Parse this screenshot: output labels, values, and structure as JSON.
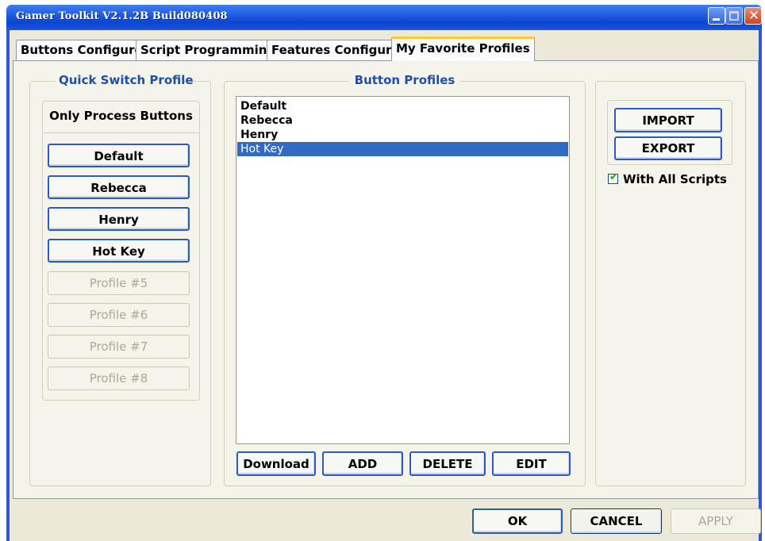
{
  "window": {
    "title": "Gamer Toolkit V2.1.2B Build080408"
  },
  "tabs": [
    {
      "label": "Buttons Configure"
    },
    {
      "label": "Script Programming"
    },
    {
      "label": "Features Configure"
    },
    {
      "label": "My Favorite Profiles",
      "active": true
    }
  ],
  "quick_switch": {
    "title": "Quick Switch Profile",
    "only_process_label": "Only Process Buttons",
    "profiles": [
      {
        "label": "Default",
        "enabled": true
      },
      {
        "label": "Rebecca",
        "enabled": true
      },
      {
        "label": "Henry",
        "enabled": true
      },
      {
        "label": "Hot Key",
        "enabled": true
      },
      {
        "label": "Profile #5",
        "enabled": false
      },
      {
        "label": "Profile #6",
        "enabled": false
      },
      {
        "label": "Profile #7",
        "enabled": false
      },
      {
        "label": "Profile #8",
        "enabled": false
      }
    ]
  },
  "button_profiles": {
    "title": "Button Profiles",
    "items": [
      "Default",
      "Rebecca",
      "Henry",
      "Hot Key"
    ],
    "selected": "Hot Key",
    "actions": {
      "download": "Download",
      "add": "ADD",
      "delete": "DELETE",
      "edit": "EDIT"
    }
  },
  "io": {
    "import": "IMPORT",
    "export": "EXPORT",
    "with_all_scripts": "With All Scripts",
    "with_all_scripts_checked": true
  },
  "footer": {
    "ok": "OK",
    "cancel": "CANCEL",
    "apply": "APPLY",
    "apply_enabled": false
  },
  "colors": {
    "title_bar": "#0a46d4",
    "selection": "#316ac5",
    "group_title": "#1e4faa",
    "active_tab_accent": "#ffc73c"
  }
}
